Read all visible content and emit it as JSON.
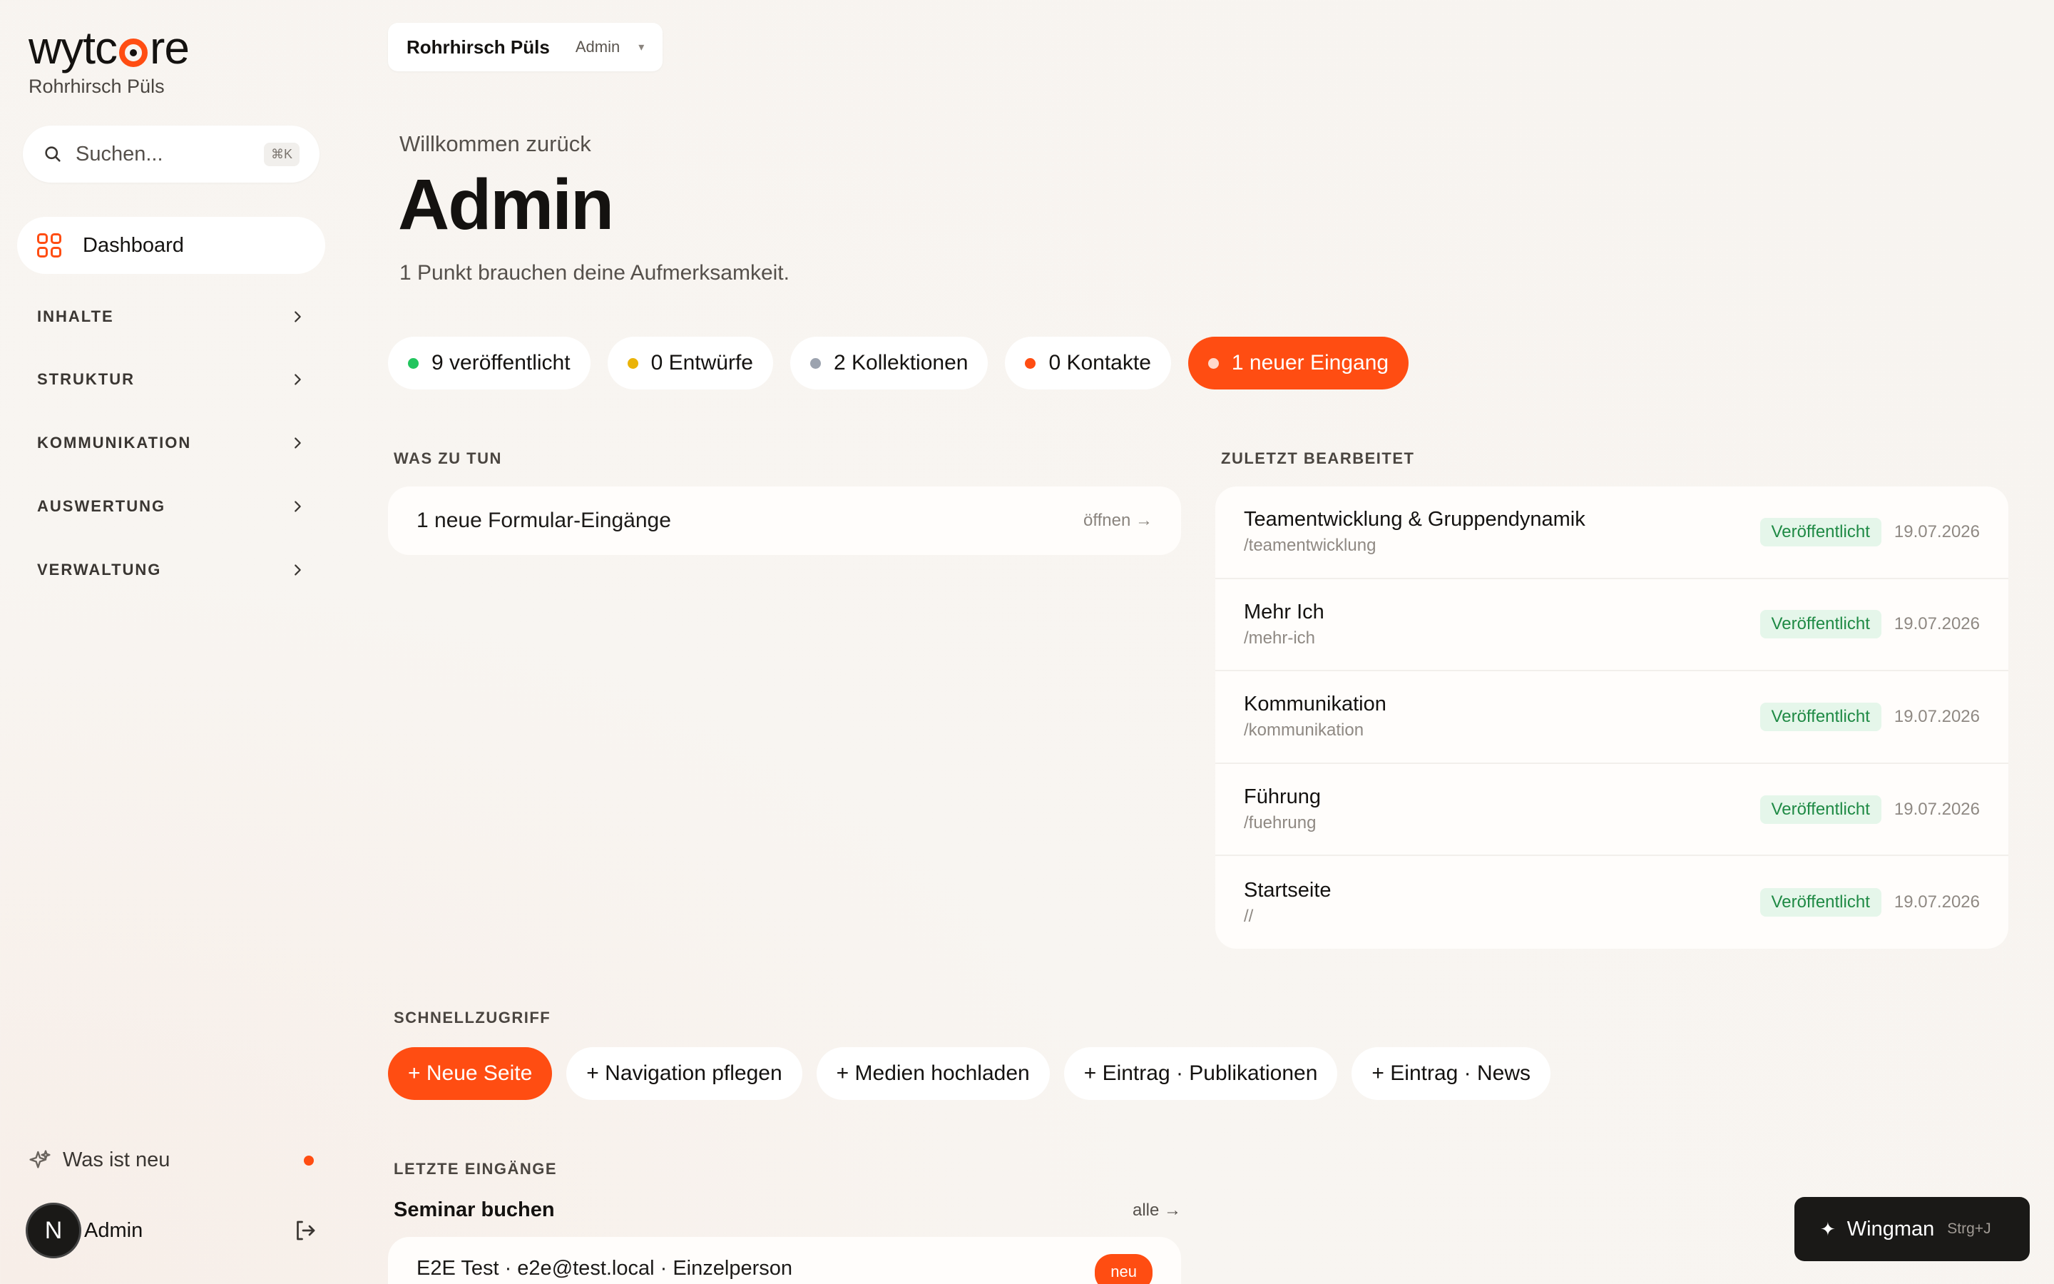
{
  "brand": {
    "logo_text_a": "wytc",
    "logo_text_b": "re",
    "org_name": "Rohrhirsch Püls",
    "accent": "#ff4d12"
  },
  "sidebar": {
    "search": {
      "placeholder": "Suchen...",
      "shortcut": "⌘K"
    },
    "active_item": {
      "label": "Dashboard",
      "icon": "dashboard-grid-icon"
    },
    "groups": [
      {
        "label": "INHALTE"
      },
      {
        "label": "STRUKTUR"
      },
      {
        "label": "KOMMUNIKATION"
      },
      {
        "label": "AUSWERTUNG"
      },
      {
        "label": "VERWALTUNG"
      }
    ],
    "whats_new": {
      "label": "Was ist neu",
      "icon": "sparkle-icon"
    },
    "user": {
      "initial": "N",
      "name": "Admin",
      "logout_icon": "logout-icon"
    }
  },
  "header": {
    "org_switch": {
      "name": "Rohrhirsch Püls",
      "role": "Admin"
    }
  },
  "hero": {
    "welcome": "Willkommen zurück",
    "title": "Admin",
    "subtitle": "1 Punkt brauchen deine Aufmerksamkeit."
  },
  "stats": [
    {
      "label": "9 veröffentlicht",
      "color": "#22c55e"
    },
    {
      "label": "0 Entwürfe",
      "color": "#eab308"
    },
    {
      "label": "2 Kollektionen",
      "color": "#9ca3af"
    },
    {
      "label": "0 Kontakte",
      "color": "#ff4d12"
    },
    {
      "label": "1 neuer Eingang",
      "color": "#ffd9cc"
    }
  ],
  "todo": {
    "heading": "WAS ZU TUN",
    "items": [
      {
        "text": "1 neue Formular-Eingänge",
        "action": "öffnen →"
      }
    ]
  },
  "recent": {
    "heading": "ZULETZT BEARBEITET",
    "items": [
      {
        "title": "Teamentwicklung & Gruppendynamik",
        "slug": "/teamentwicklung",
        "status": "Veröffentlicht",
        "date": "19.07.2026"
      },
      {
        "title": "Mehr Ich",
        "slug": "/mehr-ich",
        "status": "Veröffentlicht",
        "date": "19.07.2026"
      },
      {
        "title": "Kommunikation",
        "slug": "/kommunikation",
        "status": "Veröffentlicht",
        "date": "19.07.2026"
      },
      {
        "title": "Führung",
        "slug": "/fuehrung",
        "status": "Veröffentlicht",
        "date": "19.07.2026"
      },
      {
        "title": "Startseite",
        "slug": "//",
        "status": "Veröffentlicht",
        "date": "19.07.2026"
      }
    ]
  },
  "quick": {
    "heading": "SCHNELLZUGRIFF",
    "buttons": [
      {
        "label": "+ Neue Seite"
      },
      {
        "label": "+ Navigation pflegen"
      },
      {
        "label": "+ Medien hochladen"
      },
      {
        "label": "+ Eintrag · Publikationen"
      },
      {
        "label": "+ Eintrag · News"
      }
    ]
  },
  "inbox": {
    "heading": "LETZTE EINGÄNGE",
    "form_title": "Seminar buchen",
    "all_link": "alle →",
    "entries": [
      {
        "text": "E2E Test · e2e@test.local · Einzelperson",
        "badge": "neu"
      }
    ]
  },
  "wingman": {
    "label": "Wingman",
    "shortcut": "Strg+J",
    "icon": "sparkle-icon"
  }
}
